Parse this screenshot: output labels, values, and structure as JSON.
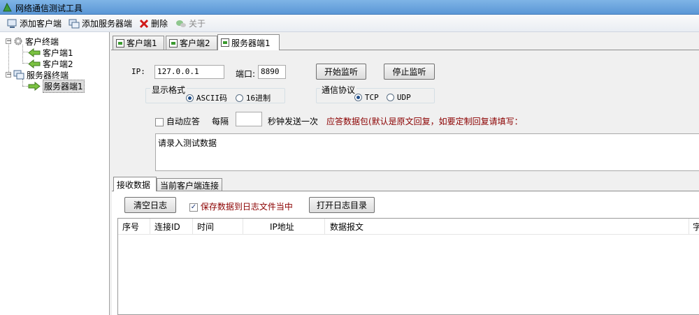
{
  "window": {
    "title": "网络通信测试工具"
  },
  "toolbar": {
    "add_client": "添加客户端",
    "add_server": "添加服务器端",
    "delete": "删除",
    "about": "关于"
  },
  "tree": {
    "client_root": "客户终端",
    "clients": [
      "客户端1",
      "客户端2"
    ],
    "server_root": "服务器终端",
    "servers": [
      "服务器端1"
    ]
  },
  "tabs": [
    "客户端1",
    "客户端2",
    "服务器端1"
  ],
  "server_panel": {
    "ip_label": "IP:",
    "ip_value": "127.0.0.1",
    "port_label": "端口:",
    "port_value": "8890",
    "start_listen": "开始监听",
    "stop_listen": "停止监听",
    "display_format_label": "显示格式",
    "format_options": [
      "ASCII码",
      "16进制"
    ],
    "protocol_label": "通信协议",
    "protocol_options": [
      "TCP",
      "UDP"
    ],
    "auto_reply_label": "自动应答",
    "every_label": "每隔",
    "interval_value": "",
    "send_once_label": "秒钟发送一次",
    "reply_hint": "应答数据包(默认是原文回复，如要定制回复请填写：",
    "test_data_placeholder": "请录入测试数据"
  },
  "sub_tabs": [
    "接收数据",
    "当前客户端连接"
  ],
  "log": {
    "clear_button": "清空日志",
    "save_to_file_label": "保存数据到日志文件当中",
    "open_dir_button": "打开日志目录"
  },
  "table": {
    "columns": [
      "序号",
      "连接ID",
      "时间",
      "IP地址",
      "数据报文",
      "字"
    ]
  }
}
